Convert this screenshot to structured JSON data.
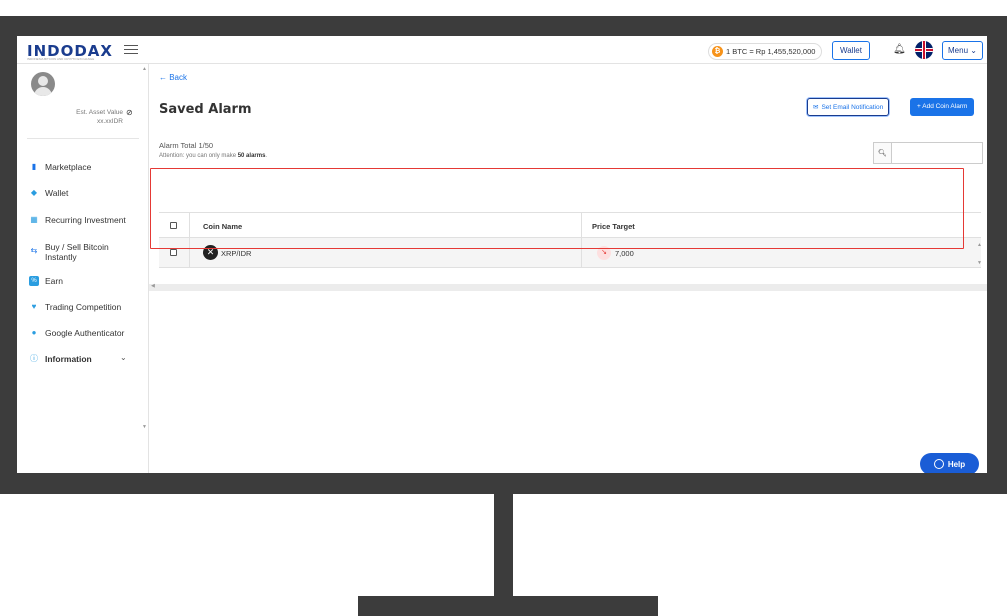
{
  "header": {
    "logo": "INDODAX",
    "logo_tagline": "INDONESIA BITCOIN AND CRYPTO EXCHANGE",
    "btc_rate": "1 BTC = Rp 1,455,520,000",
    "wallet_label": "Wallet",
    "menu_label": "Menu"
  },
  "sidebar": {
    "asset_label": "Est. Asset Value",
    "asset_value": "xx.xxIDR",
    "items": [
      {
        "label": "Marketplace",
        "icon": "bar-chart-icon",
        "color": "#1a73e8"
      },
      {
        "label": "Wallet",
        "icon": "wallet-icon",
        "color": "#2a9de0"
      },
      {
        "label": "Recurring Investment",
        "icon": "calendar-icon",
        "color": "#2a9de0"
      },
      {
        "label": "Buy / Sell Bitcoin Instantly",
        "icon": "exchange-icon",
        "color": "#1a73e8"
      },
      {
        "label": "Earn",
        "icon": "earn-icon",
        "color": "#2a9de0"
      },
      {
        "label": "Trading Competition",
        "icon": "trophy-icon",
        "color": "#2a9de0"
      },
      {
        "label": "Google Authenticator",
        "icon": "google-icon",
        "color": "#2a9de0"
      },
      {
        "label": "Information",
        "icon": "info-icon",
        "color": "#2a9de0"
      }
    ]
  },
  "main": {
    "back_label": "← Back",
    "title": "Saved Alarm",
    "email_button": "Set Email Notification",
    "add_button": "+ Add Coin Alarm",
    "alarm_total": "Alarm Total 1/50",
    "attention_prefix": "Attention: you can only make ",
    "attention_bold": "50 alarms",
    "attention_suffix": ".",
    "search_placeholder": "",
    "table": {
      "columns": [
        "Coin Name",
        "Price Target"
      ],
      "rows": [
        {
          "coin": "XRP/IDR",
          "price": "7,000"
        }
      ]
    }
  },
  "help_label": "Help",
  "colors": {
    "brand": "#1a3c8e",
    "accent": "#1a73e8",
    "highlight": "#e53935"
  }
}
